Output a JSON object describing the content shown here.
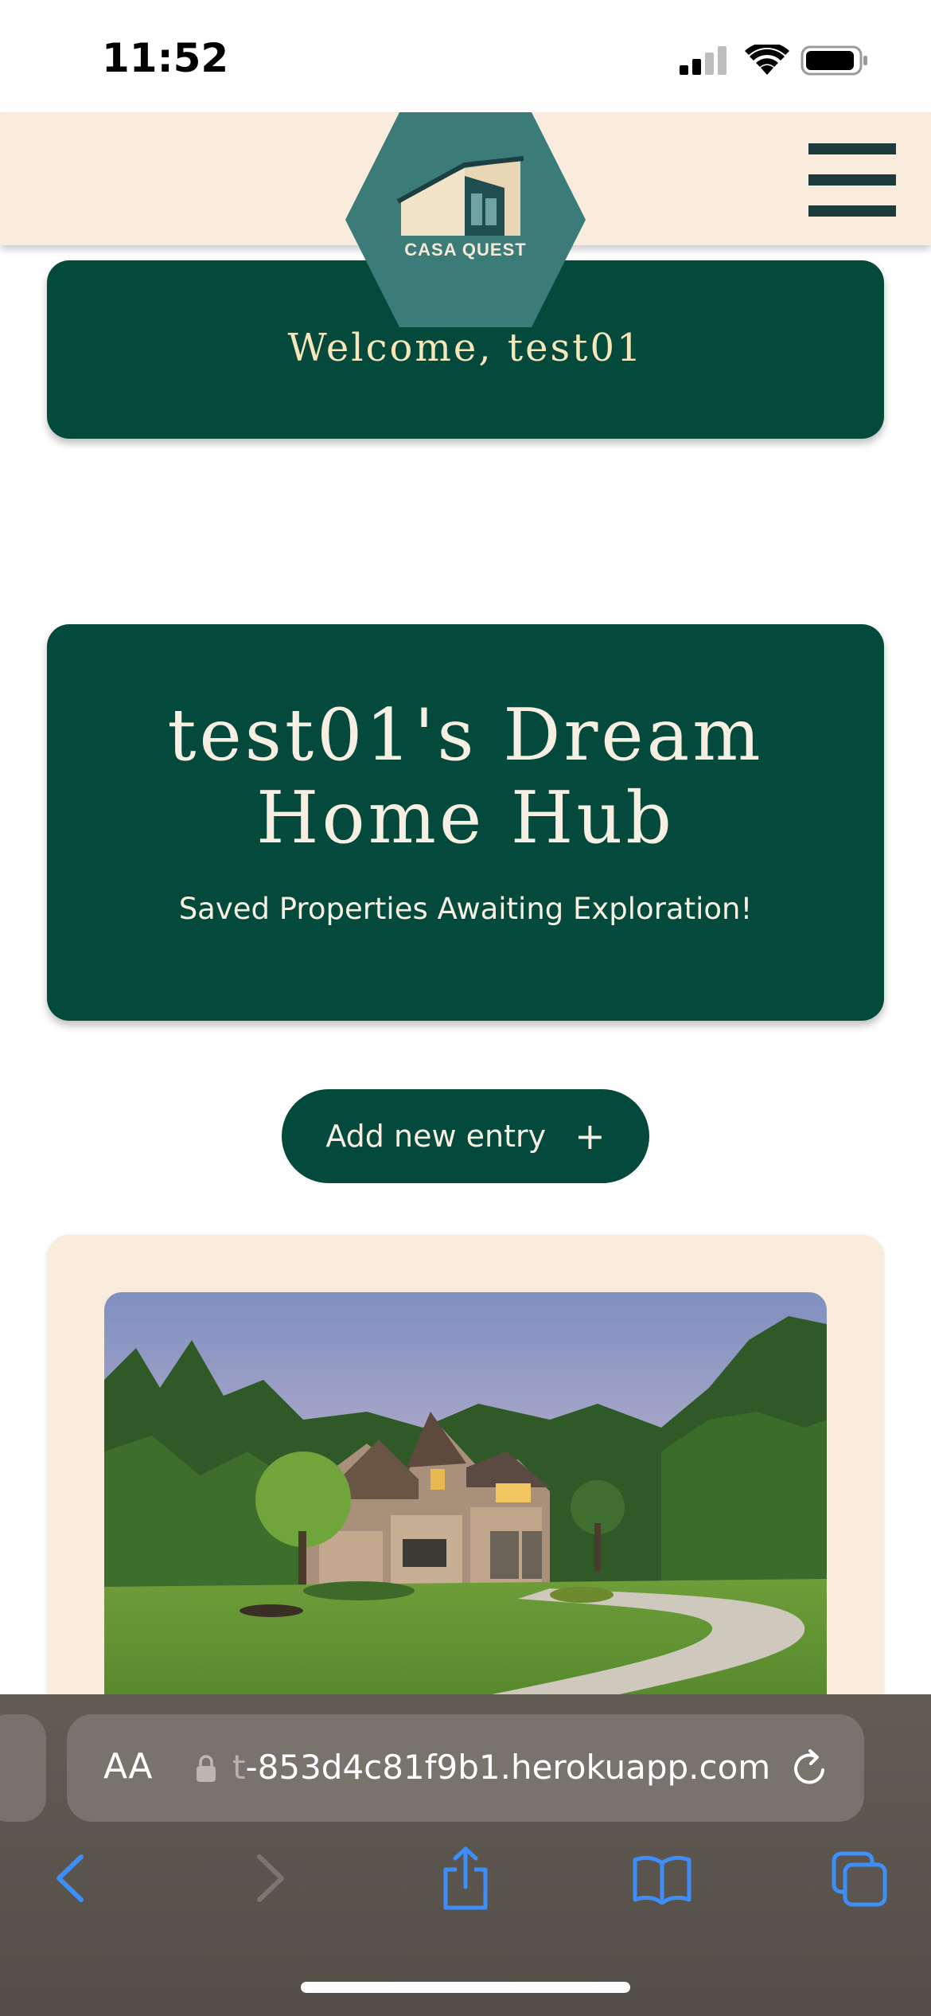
{
  "status_bar": {
    "time": "11:52",
    "icons": [
      "cellular-signal-icon",
      "wifi-icon",
      "battery-icon"
    ]
  },
  "header": {
    "logo_text": "CASA QUEST",
    "menu_icon": "hamburger-menu-icon"
  },
  "welcome": {
    "text": "Welcome, test01"
  },
  "hub": {
    "title_line1": "test01's Dream",
    "title_line2": "Home Hub",
    "subtitle": "Saved Properties Awaiting Exploration!"
  },
  "add_entry": {
    "label": "Add new entry",
    "icon": "+"
  },
  "property_card": {
    "image_icon": "house-photo"
  },
  "browser": {
    "text_size_button": "AA",
    "url_faded_prefix": "t",
    "url": "-853d4c81f9b1.herokuapp.com",
    "toolbar_icons": [
      "back-icon",
      "forward-icon",
      "share-icon",
      "bookmarks-icon",
      "tabs-icon"
    ]
  },
  "colors": {
    "brand_green": "#034a3c",
    "header_cream": "#faecdc",
    "welcome_text": "#f6e6b9",
    "logo_teal": "#3b7b78",
    "ios_blue": "#3d8ef8"
  }
}
